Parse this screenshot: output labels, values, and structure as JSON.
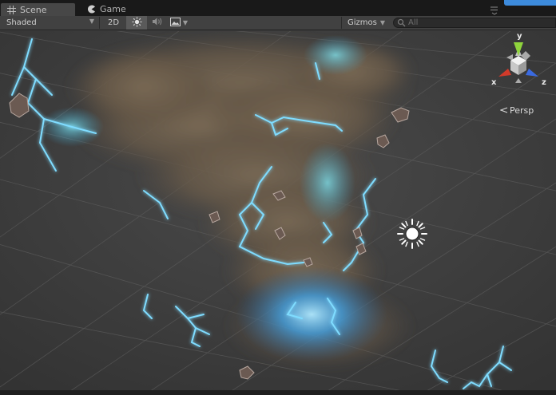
{
  "tabs": [
    {
      "label": "Scene",
      "icon": "scene-grid-icon",
      "active": true
    },
    {
      "label": "Game",
      "icon": "game-pacman-icon",
      "active": false
    }
  ],
  "toolbar": {
    "shading_mode": "Shaded",
    "mode_2d_label": "2D",
    "lighting_icon": "sun-icon",
    "audio_icon": "audio-icon",
    "effects_icon": "image-effects-icon",
    "gizmos_label": "Gizmos",
    "search_placeholder": "All"
  },
  "viewport": {
    "orientation_gizmo": {
      "axis_y": "y",
      "axis_x": "x",
      "axis_z": "z"
    },
    "projection_label": "Persp",
    "light_icon": "directional-light-icon"
  },
  "colors": {
    "tabbar": "#191919",
    "toolbar": "#414141",
    "accent": "#3d8bdc",
    "lightning": "#5fd0ff",
    "smoke": "#6e5e4b",
    "axis_x": "#d13a2a",
    "axis_y": "#8fd43c",
    "axis_z": "#3a6ae0"
  }
}
